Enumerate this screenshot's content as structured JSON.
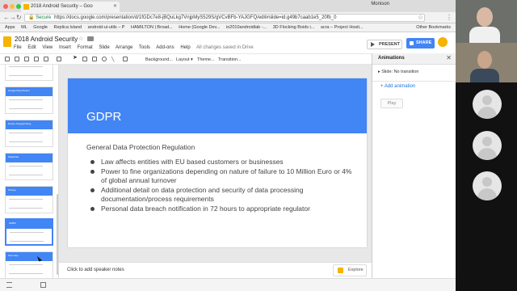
{
  "browser": {
    "tab_title": "2018 Android Security – Goo",
    "profile": "Monison",
    "secure_label": "Secure",
    "url": "https://docs.google.com/presentation/d/1fGDc7e8-jBQuLkg7VnjpMyS529S/gVCvBFb-YAJGFQ/edit#slide=id.g49b7caab1e5_20fb_0",
    "bookmarks": [
      "Apps",
      "ML",
      "Google",
      "Replica Island",
      "android-ui-utils – P",
      "HAMILTON | Broad...",
      "Home (Google Dev...",
      "io2010androidlab -...",
      "3D Flocking Boids i...",
      "acra – Project Hosti..."
    ],
    "other_bookmarks": "Other Bookmarks"
  },
  "app": {
    "doc_title": "2018 Android Security",
    "menus": [
      "File",
      "Edit",
      "View",
      "Insert",
      "Format",
      "Slide",
      "Arrange",
      "Tools",
      "Add-ons",
      "Help"
    ],
    "saved_status": "All changes saved in Drive",
    "present_label": "PRESENT",
    "share_label": "SHARE"
  },
  "toolbar": {
    "background": "Background...",
    "layout": "Layout ▾",
    "theme": "Theme...",
    "transition": "Transition..."
  },
  "filmstrip": {
    "thumb_labels": [
      "",
      "Google Play Protect",
      "Device Fingerprinting",
      "SafetyNet",
      "Privacy",
      "GDPR",
      "Summary"
    ]
  },
  "slide": {
    "title": "GDPR",
    "subtitle": "General Data Protection Regulation",
    "bullets": [
      "Law affects entities with EU based customers or businesses",
      "Power to fine organizations depending on nature of failure to 10 Million Euro or 4% of global annual turnover",
      "Additional detail on data protection and security of data processing documentation/process requirements",
      "Personal data breach notification in 72 hours to appropriate regulator"
    ]
  },
  "notes": {
    "placeholder": "Click to add speaker notes",
    "explore_label": "Explore"
  },
  "animations_panel": {
    "title": "Animations",
    "slide_transition": "Slide: No transition",
    "add_animation": "+ Add animation",
    "play": "Play"
  },
  "colors": {
    "accent_blue": "#4285f4",
    "slides_yellow": "#f4b400"
  }
}
